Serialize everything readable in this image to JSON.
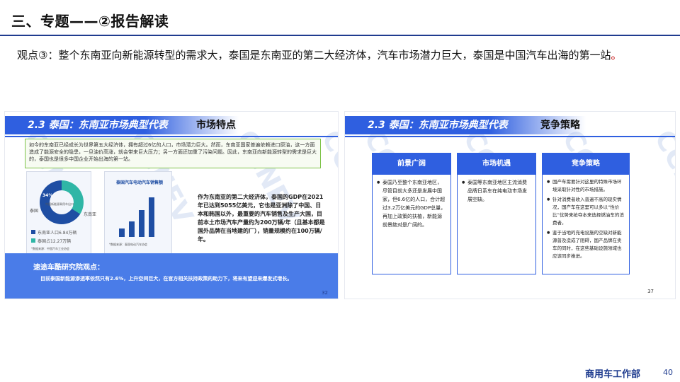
{
  "header": {
    "title": "三、专题——②报告解读"
  },
  "viewpoint": {
    "main": "观点③：整个东南亚向新能源转型的需求大，泰国是东南亚的第二大经济体，汽车市场潜力巨大，泰国是中国汽车出海的第一站",
    "tail": "。"
  },
  "left_panel": {
    "section": "2.3 泰国：东南亚市场典型代表",
    "subtitle": "市场特点",
    "intro": "如今的东南亚已经成长为世界第五大经济体，拥有超过6亿的人口，市场潜力巨大。然而，东南亚国家普遍依赖进口原油，这一方面造成了能源安全的隐患，一旦油价高涨，就会带来巨大压力；另一方面还加重了污染问题。因此，东南亚向新能源转型的需求是巨大的，泰国也是很多中国企业开始出海的第一站。",
    "donut": {
      "pct": "34%",
      "label_left": "泰国",
      "center": "中国新能源乘用车出口",
      "right_label": "东南亚",
      "legend1": "东南亚人口6.84万辆",
      "legend2": "泰国占12.27万辆",
      "note": "*数据来源：中国汽车工业协会"
    },
    "bar_title": "泰国汽车电动汽车销售额",
    "bar_note": "*数据来源：泰国电动汽车协会",
    "body": "作为东南亚的第二大经济体，泰国的GDP在2021年已达到5055亿美元，它也是亚洲除了中国、日本和韩国以外，最重要的汽车销售及生产大国，目前本土市场汽车产量约为200万辆/年（且基本都是国外品牌在当地建的厂），销量规模约在100万辆/年。",
    "band_title": "速途车酷研究院观点：",
    "band_body": "目前泰国新能源渗透率依然只有2.6%，上升空间巨大，在官方相关扶持政策的助力下，将来有望迎来爆发式增长。",
    "page": "32"
  },
  "right_panel": {
    "section": "2.3 泰国：东南亚市场典型代表",
    "subtitle": "竞争策略",
    "columns": [
      {
        "head": "前景广阔",
        "items": [
          "泰国乃至整个东南亚地区，尽管目前大多还是发展中国家，但6.6亿的人口，合计超过3.2万亿美元的GDP总量，再加上政策的扶植，新能源前景绝对是广阔的。"
        ]
      },
      {
        "head": "市场机遇",
        "items": [
          "泰国等东南亚地区主流消费品牌日系车在纯电动市场发展空缺。"
        ]
      },
      {
        "head": "竞争策略",
        "items": [
          "国产车需要针对这里的特殊市场环境采取针对性的市场措施。",
          "针对消费者收入普遍不高的现实情况，国产车在这里可以多以“性价比”优势来抢夺本来选择燃油车的消费者。",
          "鉴于当地的充电设施的空缺对新能源普及造成了阻碍，国产品牌在卖车的同时，在这些基础设施领域也应该同步推进。"
        ]
      }
    ],
    "page": "37"
  },
  "footer": {
    "dept": "商用车工作部",
    "page": "40"
  },
  "watermark": "CCNEV"
}
